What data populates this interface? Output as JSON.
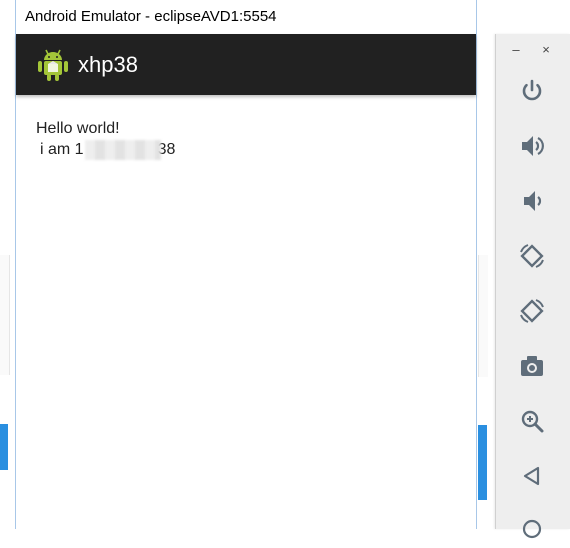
{
  "window": {
    "title": "Android Emulator - eclipseAVD1:5554"
  },
  "app": {
    "title": "xhp38"
  },
  "content": {
    "line1": "Hello world!",
    "line2_prefix": "i am 1",
    "line2_suffix": "38"
  },
  "panel": {
    "minimize": "–",
    "close": "×",
    "buttons": [
      {
        "icon": "power-icon"
      },
      {
        "icon": "volume-up-icon"
      },
      {
        "icon": "volume-down-icon"
      },
      {
        "icon": "rotate-left-icon"
      },
      {
        "icon": "rotate-right-icon"
      },
      {
        "icon": "camera-icon"
      },
      {
        "icon": "zoom-icon"
      },
      {
        "icon": "back-icon"
      },
      {
        "icon": "home-icon"
      }
    ]
  },
  "colors": {
    "actionbar": "#212121",
    "panel_icon": "#5f6d7a",
    "android_green": "#a4c639"
  }
}
